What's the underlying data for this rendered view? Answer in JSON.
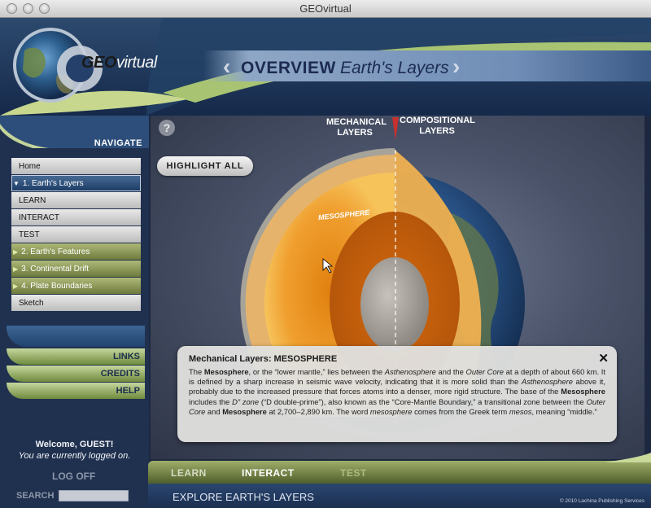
{
  "window": {
    "title": "GEOvirtual"
  },
  "logo": {
    "geo": "GEO",
    "virtual": "virtual"
  },
  "banner": {
    "section": "OVERVIEW",
    "topic": "Earth's Layers",
    "prev_glyph": "‹",
    "next_glyph": "›"
  },
  "sidebar": {
    "navigate_label": "NAVIGATE",
    "items": [
      {
        "label": "Home"
      },
      {
        "label": "1. Earth's Layers"
      },
      {
        "label": "LEARN"
      },
      {
        "label": "INTERACT"
      },
      {
        "label": "TEST"
      },
      {
        "label": "2. Earth's Features"
      },
      {
        "label": "3. Continental Drift"
      },
      {
        "label": "4. Plate Boundaries"
      },
      {
        "label": "Sketch"
      }
    ],
    "buttons": {
      "links": "LINKS",
      "credits": "CREDITS",
      "help": "HELP"
    },
    "welcome": "Welcome, GUEST!",
    "logged_on": "You are currently logged on.",
    "log_off": "LOG OFF",
    "search_label": "SEARCH",
    "search_value": ""
  },
  "stage": {
    "help_glyph": "?",
    "highlight_all": "HIGHLIGHT ALL",
    "mechanical_label_1": "MECHANICAL",
    "mechanical_label_2": "LAYERS",
    "compositional_label_1": "COMPOSITIONAL",
    "compositional_label_2": "LAYERS",
    "mesosphere_label": "MESOSPHERE"
  },
  "popup": {
    "title": "Mechanical Layers: MESOSPHERE",
    "close_glyph": "✕",
    "text": [
      {
        "t": "The "
      },
      {
        "b": "Mesosphere"
      },
      {
        "t": ", or the “lower mantle,” lies between the "
      },
      {
        "i": "Asthenosphere"
      },
      {
        "t": " and the "
      },
      {
        "i": "Outer Core"
      },
      {
        "t": " at a depth of about 660 km. It is defined by a sharp increase in seismic wave velocity, indicating that it is more solid than the "
      },
      {
        "i": "Asthenosphere"
      },
      {
        "t": " above it, probably due to the increased pressure that forces atoms into a denser, more rigid structure. The base of the "
      },
      {
        "b": "Mesosphere"
      },
      {
        "t": " includes the "
      },
      {
        "i": "D” zone"
      },
      {
        "t": " (“D double-prime”), also known as the “Core-Mantle Boundary,” a transitional zone between the "
      },
      {
        "i": "Outer Core"
      },
      {
        "t": " and "
      },
      {
        "b": "Mesosphere"
      },
      {
        "t": " at 2,700–2,890 km. The word "
      },
      {
        "i": "mesosphere"
      },
      {
        "t": " comes from the Greek term "
      },
      {
        "i": "mesos"
      },
      {
        "t": ", meaning “middle.”"
      }
    ]
  },
  "tabs": [
    {
      "label": "LEARN",
      "color": "#d6dcc3"
    },
    {
      "label": "INTERACT",
      "color": "#ffffff"
    },
    {
      "label": "TEST",
      "color": "#aebb82"
    }
  ],
  "footer": {
    "explore": "EXPLORE EARTH'S LAYERS",
    "copyright": "© 2010 Lachina Publishing Services"
  }
}
